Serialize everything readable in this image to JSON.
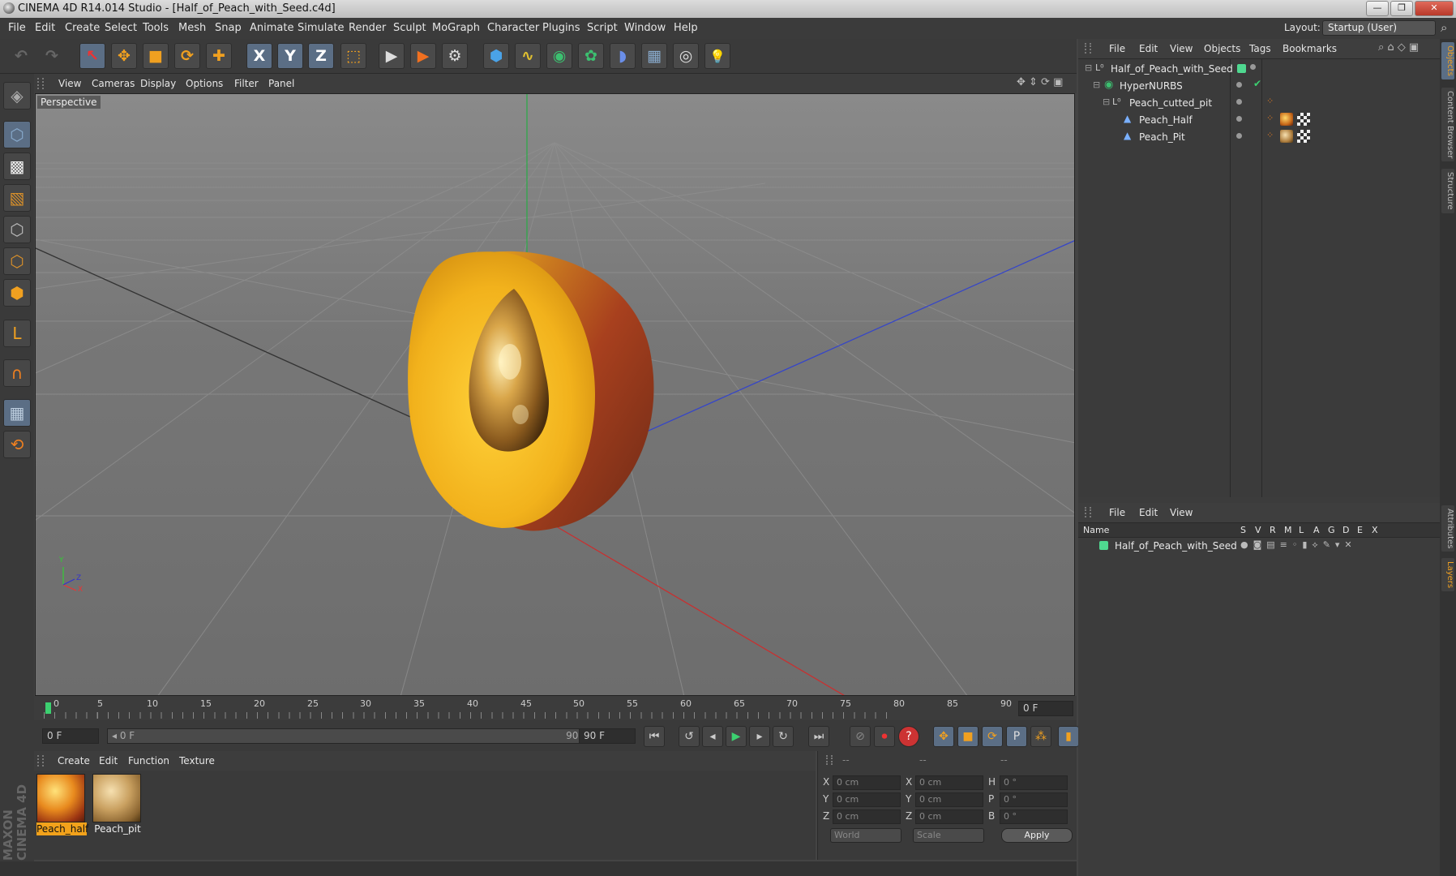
{
  "window": {
    "title": "CINEMA 4D R14.014 Studio - [Half_of_Peach_with_Seed.c4d]",
    "buttons": [
      "—",
      "❐",
      "✕"
    ]
  },
  "menu": [
    "File",
    "Edit",
    "Create",
    "Select",
    "Tools",
    "Mesh",
    "Snap",
    "Animate",
    "Simulate",
    "Render",
    "Sculpt",
    "MoGraph",
    "Character",
    "Plugins",
    "Script",
    "Window",
    "Help"
  ],
  "layout": {
    "label": "Layout:",
    "value": "Startup (User)"
  },
  "toolbar": [
    {
      "name": "undo-icon",
      "glyph": "↶"
    },
    {
      "name": "redo-icon",
      "glyph": "↷"
    },
    {
      "name": "live-selection-icon",
      "glyph": "↖"
    },
    {
      "name": "move-icon",
      "glyph": "✥"
    },
    {
      "name": "scale-icon",
      "glyph": "■"
    },
    {
      "name": "rotate-icon",
      "glyph": "⟳"
    },
    {
      "name": "add-icon",
      "glyph": "✚"
    },
    {
      "name": "x-axis-icon",
      "glyph": "X"
    },
    {
      "name": "y-axis-icon",
      "glyph": "Y"
    },
    {
      "name": "z-axis-icon",
      "glyph": "Z"
    },
    {
      "name": "coordinate-system-icon",
      "glyph": "⬚"
    },
    {
      "name": "render-view-icon",
      "glyph": "▶"
    },
    {
      "name": "render-picture-viewer-icon",
      "glyph": "▶"
    },
    {
      "name": "render-settings-icon",
      "glyph": "⚙"
    },
    {
      "name": "cube-icon",
      "glyph": "⬢"
    },
    {
      "name": "spline-icon",
      "glyph": "∿"
    },
    {
      "name": "nurbs-icon",
      "glyph": "◉"
    },
    {
      "name": "array-icon",
      "glyph": "✿"
    },
    {
      "name": "deformer-icon",
      "glyph": "◗"
    },
    {
      "name": "floor-icon",
      "glyph": "▦"
    },
    {
      "name": "camera-icon",
      "glyph": "◎"
    },
    {
      "name": "light-icon",
      "glyph": "💡"
    }
  ],
  "left_tools": [
    {
      "name": "make-editable-icon",
      "glyph": "◈"
    },
    {
      "name": "model-mode-icon",
      "glyph": "⬡"
    },
    {
      "name": "texture-mode-icon",
      "glyph": "▩"
    },
    {
      "name": "workplane-icon",
      "glyph": "▧"
    },
    {
      "name": "points-mode-icon",
      "glyph": "⬡"
    },
    {
      "name": "edges-mode-icon",
      "glyph": "⬡"
    },
    {
      "name": "polygons-mode-icon",
      "glyph": "⬢"
    },
    {
      "name": "axis-mode-icon",
      "glyph": "L"
    },
    {
      "name": "magnet-icon",
      "glyph": "∩"
    },
    {
      "name": "snap-grid-icon",
      "glyph": "▦"
    },
    {
      "name": "snap-settings-icon",
      "glyph": "⟲"
    }
  ],
  "viewport": {
    "menu": [
      "View",
      "Cameras",
      "Display",
      "Options",
      "Filter",
      "Panel"
    ],
    "label": "Perspective",
    "axis_labels": {
      "y": "Y",
      "x": "X",
      "z": "Z"
    }
  },
  "timeline": {
    "ticks": [
      "0",
      "5",
      "10",
      "15",
      "20",
      "25",
      "30",
      "35",
      "40",
      "45",
      "50",
      "55",
      "60",
      "65",
      "70",
      "75",
      "80",
      "85",
      "90"
    ],
    "frame_field": "0 F",
    "start_field": "0 F",
    "range_left": "◂ 0 F",
    "range_right": "90 F ▸",
    "end_field": "90 F"
  },
  "playback": [
    {
      "name": "go-to-start-icon",
      "glyph": "⏮"
    },
    {
      "name": "prev-key-icon",
      "glyph": "↺"
    },
    {
      "name": "prev-frame-icon",
      "glyph": "◂"
    },
    {
      "name": "play-icon",
      "glyph": "▶"
    },
    {
      "name": "next-frame-icon",
      "glyph": "▸"
    },
    {
      "name": "next-key-icon",
      "glyph": "↻"
    },
    {
      "name": "go-to-end-icon",
      "glyph": "⏭"
    },
    {
      "name": "record-keys-icon",
      "glyph": "⊘"
    },
    {
      "name": "autokey-icon",
      "glyph": "⏺"
    },
    {
      "name": "keyframe-help-icon",
      "glyph": "?"
    },
    {
      "name": "key-position-icon",
      "glyph": "✥"
    },
    {
      "name": "key-scale-icon",
      "glyph": "■"
    },
    {
      "name": "key-rotation-icon",
      "glyph": "⟳"
    },
    {
      "name": "key-param-icon",
      "glyph": "P"
    },
    {
      "name": "key-pla-icon",
      "glyph": "⁂"
    },
    {
      "name": "timeline-icon",
      "glyph": "▮"
    }
  ],
  "materials": {
    "menu": [
      "Create",
      "Edit",
      "Function",
      "Texture"
    ],
    "items": [
      {
        "label": "Peach_half"
      },
      {
        "label": "Peach_pit"
      }
    ]
  },
  "coordinates": {
    "headers": [
      "--",
      "--",
      "--"
    ],
    "rows": [
      {
        "a": "X",
        "av": "0 cm",
        "b": "X",
        "bv": "0 cm",
        "c": "H",
        "cv": "0 °"
      },
      {
        "a": "Y",
        "av": "0 cm",
        "b": "Y",
        "bv": "0 cm",
        "c": "P",
        "cv": "0 °"
      },
      {
        "a": "Z",
        "av": "0 cm",
        "b": "Z",
        "bv": "0 cm",
        "c": "B",
        "cv": "0 °"
      }
    ],
    "world": "World",
    "scale": "Scale",
    "apply": "Apply"
  },
  "objects_panel": {
    "menu": [
      "File",
      "Edit",
      "View",
      "Objects",
      "Tags",
      "Bookmarks"
    ],
    "items": [
      {
        "label": "Half_of_Peach_with_Seed"
      },
      {
        "label": "HyperNURBS"
      },
      {
        "label": "Peach_cutted_pit"
      },
      {
        "label": "Peach_Half"
      },
      {
        "label": "Peach_Pit"
      }
    ]
  },
  "layers_panel": {
    "menu": [
      "File",
      "Edit",
      "View"
    ],
    "name_header": "Name",
    "col_headers": [
      "S",
      "V",
      "R",
      "M",
      "L",
      "A",
      "G",
      "D",
      "E",
      "X"
    ],
    "items": [
      {
        "label": "Half_of_Peach_with_Seed"
      }
    ]
  },
  "side_tabs": [
    "Objects",
    "Content Browser",
    "Structure",
    "Attributes",
    "Layers"
  ],
  "brand": "MAXON CINEMA 4D",
  "colors": {
    "accent": "#5b6e85",
    "layer_green": "#4fd890",
    "material_selected": "#f2a21b"
  }
}
